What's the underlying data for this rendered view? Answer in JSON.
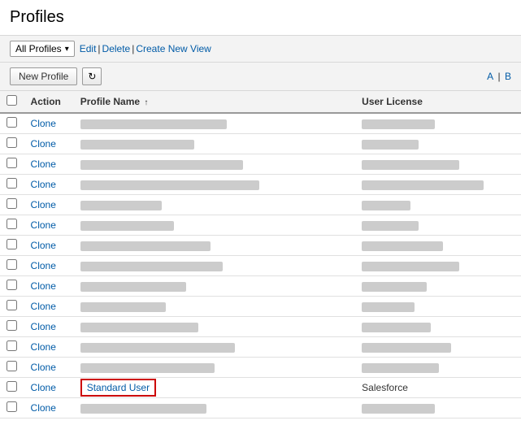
{
  "page": {
    "title": "Profiles",
    "breadcrumb": "Profiles"
  },
  "view_bar": {
    "select_label": "All Profiles",
    "links": [
      {
        "label": "Edit",
        "href": "#"
      },
      {
        "label": "Delete",
        "href": "#"
      },
      {
        "label": "Create New View",
        "href": "#"
      }
    ]
  },
  "toolbar": {
    "new_profile_label": "New Profile",
    "refresh_icon": "↻",
    "pagination": {
      "a_label": "A",
      "b_label": "B"
    }
  },
  "table": {
    "columns": [
      {
        "id": "checkbox",
        "label": ""
      },
      {
        "id": "action",
        "label": "Action"
      },
      {
        "id": "profile_name",
        "label": "Profile Name",
        "sort": "asc"
      },
      {
        "id": "user_license",
        "label": "User License"
      }
    ],
    "rows": [
      {
        "id": 1,
        "action": "Clone",
        "profile_name": "",
        "profile_name_width": 180,
        "user_license": "",
        "ul_width": 90,
        "highlighted": false
      },
      {
        "id": 2,
        "action": "Clone",
        "profile_name": "",
        "profile_name_width": 140,
        "user_license": "",
        "ul_width": 70,
        "highlighted": false
      },
      {
        "id": 3,
        "action": "Clone",
        "profile_name": "",
        "profile_name_width": 200,
        "user_license": "",
        "ul_width": 120,
        "highlighted": false
      },
      {
        "id": 4,
        "action": "Clone",
        "profile_name": "",
        "profile_name_width": 220,
        "user_license": "",
        "ul_width": 150,
        "highlighted": false
      },
      {
        "id": 5,
        "action": "Clone",
        "profile_name": "",
        "profile_name_width": 100,
        "user_license": "",
        "ul_width": 60,
        "highlighted": false
      },
      {
        "id": 6,
        "action": "Clone",
        "profile_name": "",
        "profile_name_width": 115,
        "user_license": "",
        "ul_width": 70,
        "highlighted": false
      },
      {
        "id": 7,
        "action": "Clone",
        "profile_name": "",
        "profile_name_width": 160,
        "user_license": "",
        "ul_width": 100,
        "highlighted": false
      },
      {
        "id": 8,
        "action": "Clone",
        "profile_name": "",
        "profile_name_width": 175,
        "user_license": "",
        "ul_width": 120,
        "highlighted": false
      },
      {
        "id": 9,
        "action": "Clone",
        "profile_name": "",
        "profile_name_width": 130,
        "user_license": "",
        "ul_width": 80,
        "highlighted": false
      },
      {
        "id": 10,
        "action": "Clone",
        "profile_name": "",
        "profile_name_width": 105,
        "user_license": "",
        "ul_width": 65,
        "highlighted": false
      },
      {
        "id": 11,
        "action": "Clone",
        "profile_name": "",
        "profile_name_width": 145,
        "user_license": "",
        "ul_width": 85,
        "highlighted": false
      },
      {
        "id": 12,
        "action": "Clone",
        "profile_name": "",
        "profile_name_width": 190,
        "user_license": "",
        "ul_width": 110,
        "highlighted": false
      },
      {
        "id": 13,
        "action": "Clone",
        "profile_name": "",
        "profile_name_width": 165,
        "user_license": "",
        "ul_width": 95,
        "highlighted": false
      },
      {
        "id": 14,
        "action": "Clone",
        "profile_name": "Standard User",
        "profile_name_width": 0,
        "user_license": "Salesforce",
        "ul_width": 0,
        "highlighted": true
      },
      {
        "id": 15,
        "action": "Clone",
        "profile_name": "",
        "profile_name_width": 155,
        "user_license": "",
        "ul_width": 90,
        "highlighted": false
      }
    ]
  },
  "icons": {
    "refresh": "↻",
    "sort_asc": "↑",
    "dropdown_arrow": "▾"
  }
}
